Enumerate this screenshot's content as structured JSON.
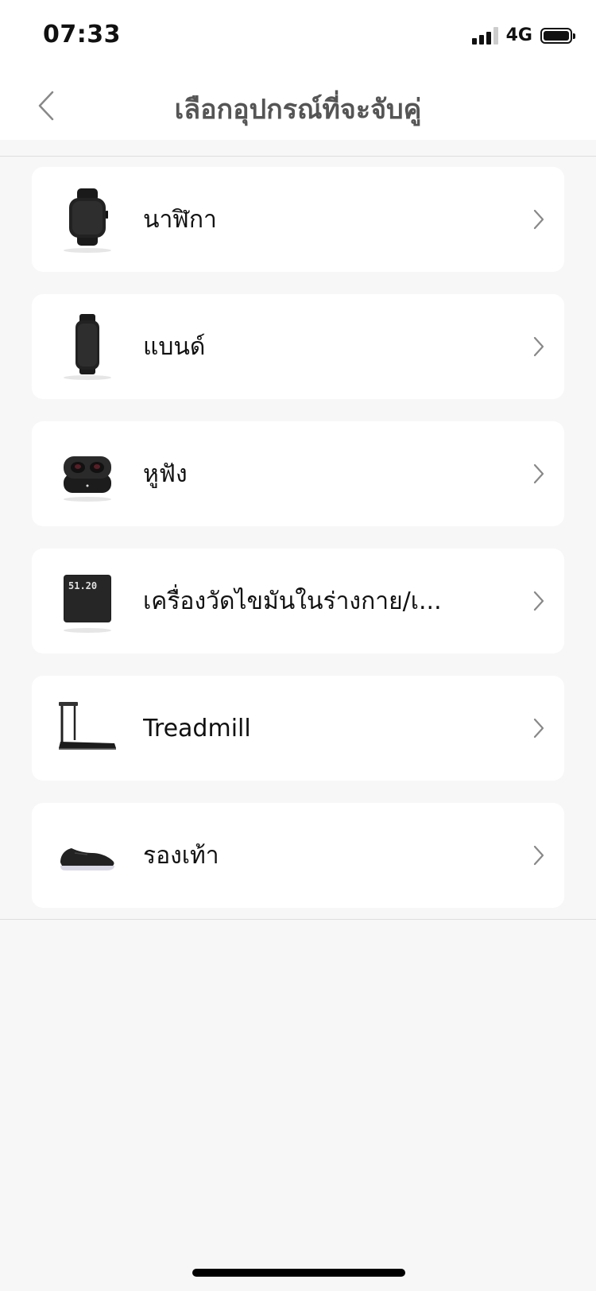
{
  "status_bar": {
    "time": "07:33",
    "network": "4G"
  },
  "nav": {
    "title": "เลือกอุปกรณ์ที่จะจับคู่"
  },
  "devices": [
    {
      "label": "นาฬิกา",
      "icon": "watch-icon"
    },
    {
      "label": "แบนด์",
      "icon": "band-icon"
    },
    {
      "label": "หูฟัง",
      "icon": "earbuds-icon"
    },
    {
      "label": "เครื่องวัดไขมันในร่างกาย/เ...",
      "icon": "scale-icon",
      "scale_display": "51.20"
    },
    {
      "label": "Treadmill",
      "icon": "treadmill-icon"
    },
    {
      "label": "รองเท้า",
      "icon": "shoe-icon"
    }
  ],
  "colors": {
    "background": "#f7f7f7",
    "card": "#ffffff",
    "title": "#555555",
    "chevron": "#888888"
  }
}
